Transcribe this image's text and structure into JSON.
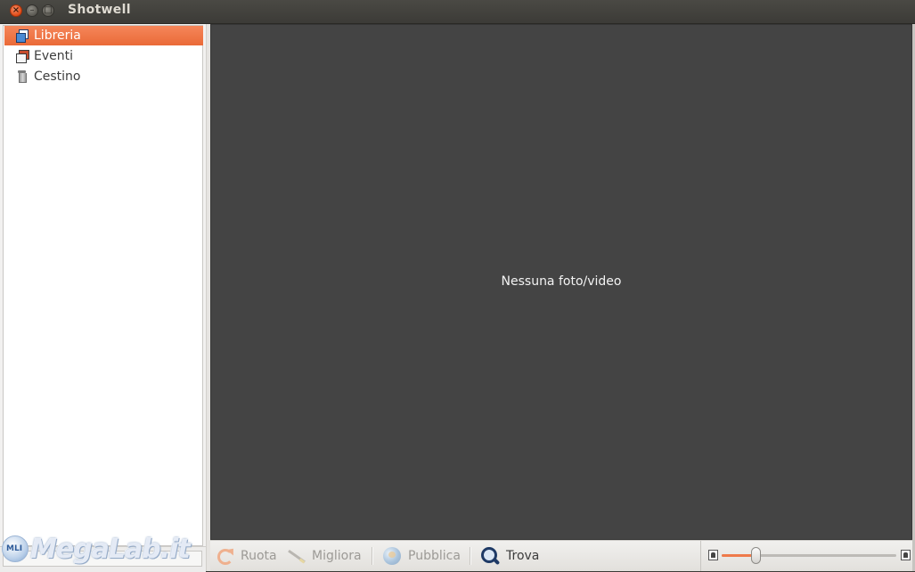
{
  "window": {
    "title": "Shotwell",
    "controls": {
      "close": "×",
      "minimize": "–",
      "maximize": "□"
    }
  },
  "sidebar": {
    "items": [
      {
        "label": "Libreria",
        "icon": "library-icon",
        "selected": true
      },
      {
        "label": "Eventi",
        "icon": "events-icon",
        "selected": false
      },
      {
        "label": "Cestino",
        "icon": "trash-icon",
        "selected": false
      }
    ]
  },
  "viewer": {
    "empty_message": "Nessuna foto/video"
  },
  "toolbar": {
    "rotate": {
      "label": "Ruota",
      "icon": "rotate-icon",
      "enabled": false
    },
    "enhance": {
      "label": "Migliora",
      "icon": "enhance-wand-icon",
      "enabled": false
    },
    "publish": {
      "label": "Pubblica",
      "icon": "publish-globe-icon",
      "enabled": false
    },
    "find": {
      "label": "Trova",
      "icon": "search-icon",
      "enabled": true
    }
  },
  "zoom": {
    "level": 0.2
  },
  "watermark": {
    "badge": "MLI",
    "text": "MegaLab.it"
  },
  "colors": {
    "accent": "#ea6a38",
    "viewer_bg": "#444444",
    "titlebar_bg": "#3c3b37"
  }
}
